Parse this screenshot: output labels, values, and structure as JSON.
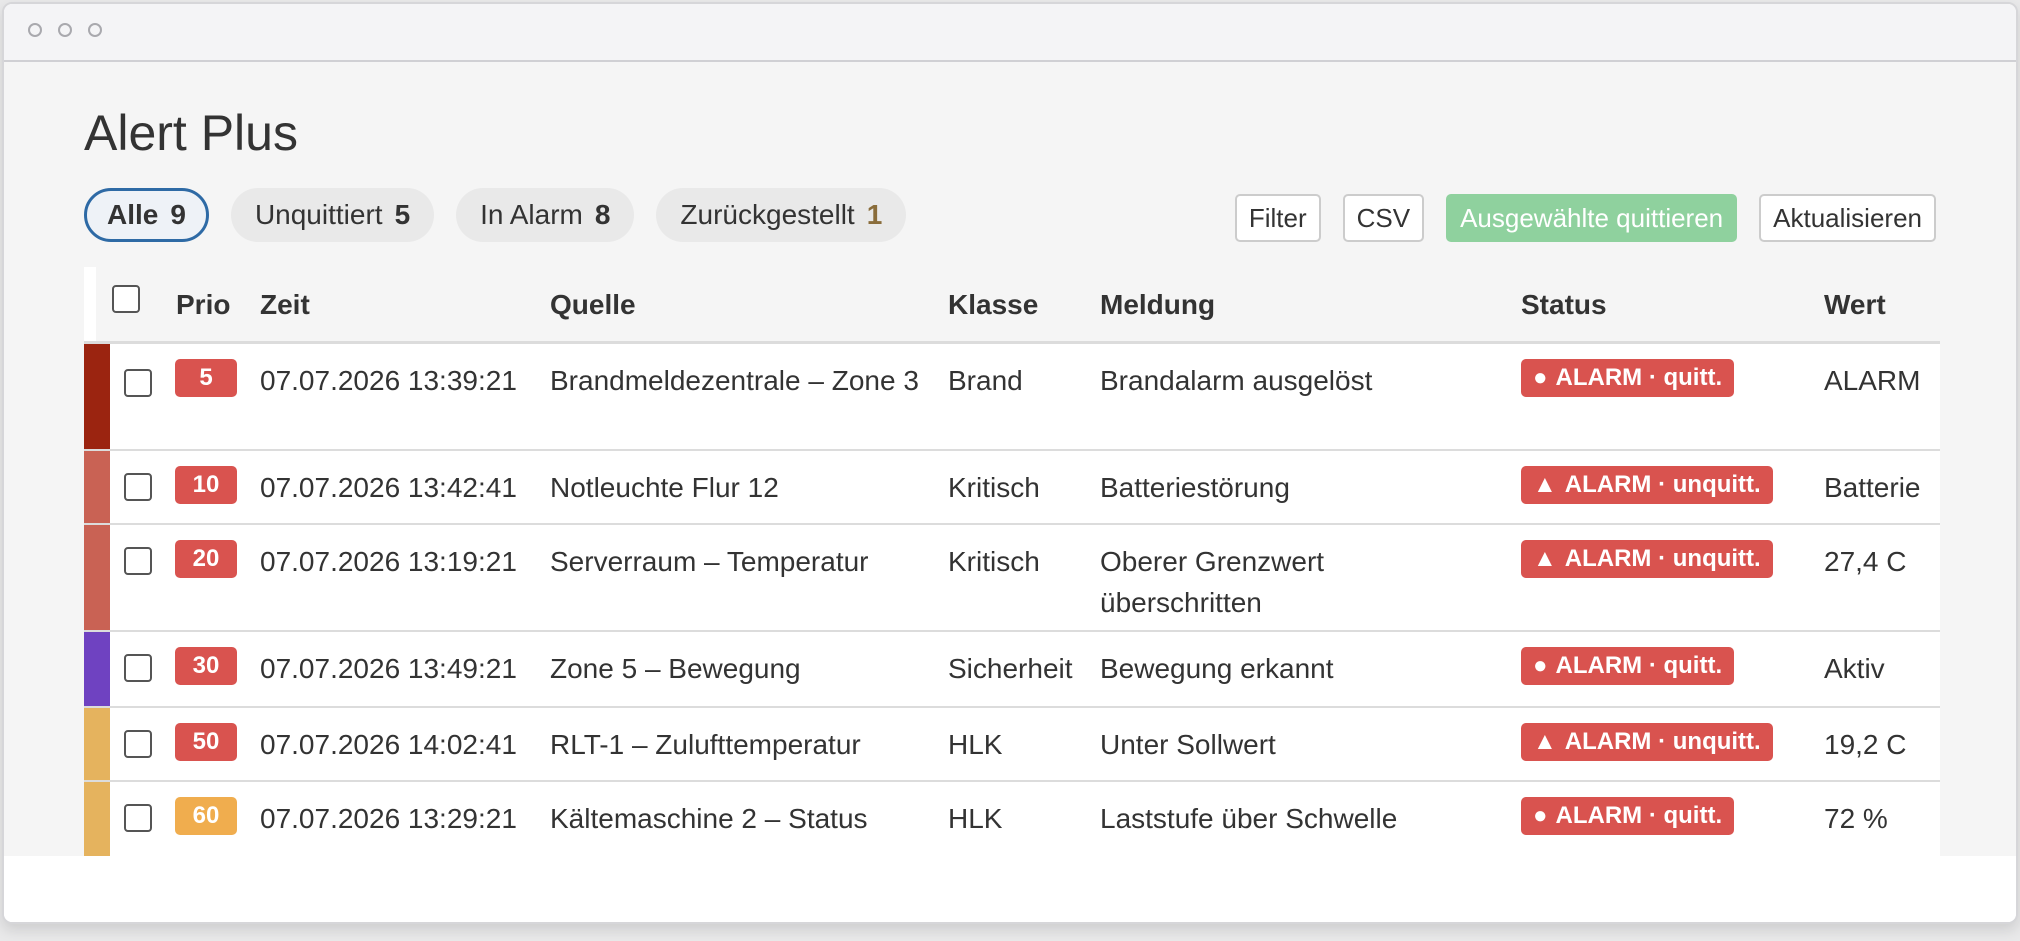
{
  "window": {
    "controls": [
      "close",
      "minimize",
      "maximize"
    ]
  },
  "page": {
    "title": "Alert Plus"
  },
  "tabs": [
    {
      "label": "Alle",
      "count": "9"
    },
    {
      "label": "Unquittiert",
      "count": "5"
    },
    {
      "label": "In Alarm",
      "count": "8"
    },
    {
      "label": "Zurückgestellt",
      "count": "1"
    }
  ],
  "toolbar": {
    "filter": "Filter",
    "csv": "CSV",
    "ack_selected": "Ausgewählte quittieren",
    "refresh": "Aktualisieren"
  },
  "table": {
    "columns": [
      "Prio",
      "Zeit",
      "Quelle",
      "Klasse",
      "Meldung",
      "Status",
      "Wert"
    ],
    "rows": [
      {
        "prio": "5",
        "zeit": "07.07.2026 13:39:21",
        "quelle": "Brandmeldezentrale – Zone 3",
        "klasse": "Brand",
        "meldung": "Brandalarm ausgelöst",
        "status": "ALARM · quitt.",
        "status_symbol": "●",
        "wert": "ALARM",
        "stripe_color": "#9b2410",
        "prio_color": "#d9534f"
      },
      {
        "prio": "10",
        "zeit": "07.07.2026 13:42:41",
        "quelle": "Notleuchte Flur 12",
        "klasse": "Kritisch",
        "meldung": "Batteriestörung",
        "status": "ALARM · unquitt.",
        "status_symbol": "▲",
        "wert": "Batterie",
        "stripe_color": "#c96254",
        "prio_color": "#d9534f"
      },
      {
        "prio": "20",
        "zeit": "07.07.2026 13:19:21",
        "quelle": "Serverraum – Temperatur",
        "klasse": "Kritisch",
        "meldung": "Oberer Grenzwert überschritten",
        "status": "ALARM · unquitt.",
        "status_symbol": "▲",
        "wert": "27,4 C",
        "stripe_color": "#c96254",
        "prio_color": "#d9534f"
      },
      {
        "prio": "30",
        "zeit": "07.07.2026 13:49:21",
        "quelle": "Zone 5 – Bewegung",
        "klasse": "Sicherheit",
        "meldung": "Bewegung erkannt",
        "status": "ALARM · quitt.",
        "status_symbol": "●",
        "wert": "Aktiv",
        "stripe_color": "#6f42c1",
        "prio_color": "#d9534f"
      },
      {
        "prio": "50",
        "zeit": "07.07.2026 14:02:41",
        "quelle": "RLT-1 – Zulufttemperatur",
        "klasse": "HLK",
        "meldung": "Unter Sollwert",
        "status": "ALARM · unquitt.",
        "status_symbol": "▲",
        "wert": "19,2 C",
        "stripe_color": "#e5b35e",
        "prio_color": "#d9534f"
      },
      {
        "prio": "60",
        "zeit": "07.07.2026 13:29:21",
        "quelle": "Kältemaschine 2 – Status",
        "klasse": "HLK",
        "meldung": "Laststufe über Schwelle",
        "status": "ALARM · quitt.",
        "status_symbol": "●",
        "wert": "72 %",
        "stripe_color": "#e5b35e",
        "prio_color": "#f0ad4e"
      }
    ]
  }
}
